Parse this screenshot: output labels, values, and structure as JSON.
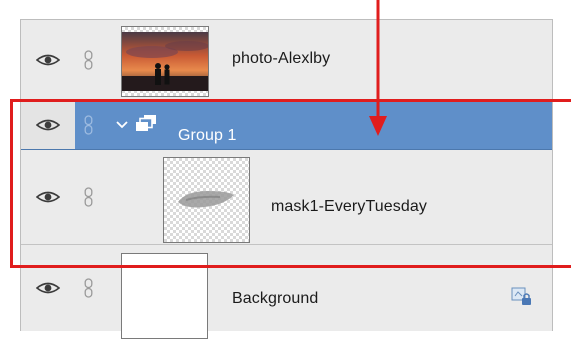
{
  "layers": [
    {
      "name": "photo-Alexlby",
      "thumbnail": "photo-couple-sunset",
      "visible": true,
      "type": "layer"
    },
    {
      "name": "Group 1",
      "type": "group",
      "expanded": true,
      "visible": true,
      "selected": true
    },
    {
      "name": "mask1-EveryTuesday",
      "thumbnail": "mask-shape",
      "visible": true,
      "type": "layer"
    },
    {
      "name": "Background",
      "thumbnail": "blank",
      "visible": true,
      "locked": true,
      "type": "layer"
    }
  ],
  "icons": {
    "visibility": "eye-icon",
    "link": "chain-link-icon",
    "group_toggle": "chevron-down-icon",
    "group": "layer-group-icon",
    "lock": "lock-icon"
  },
  "colors": {
    "group_selected": "#5f8fc9",
    "annotation": "#e01d1d",
    "panel": "#ebebeb"
  }
}
